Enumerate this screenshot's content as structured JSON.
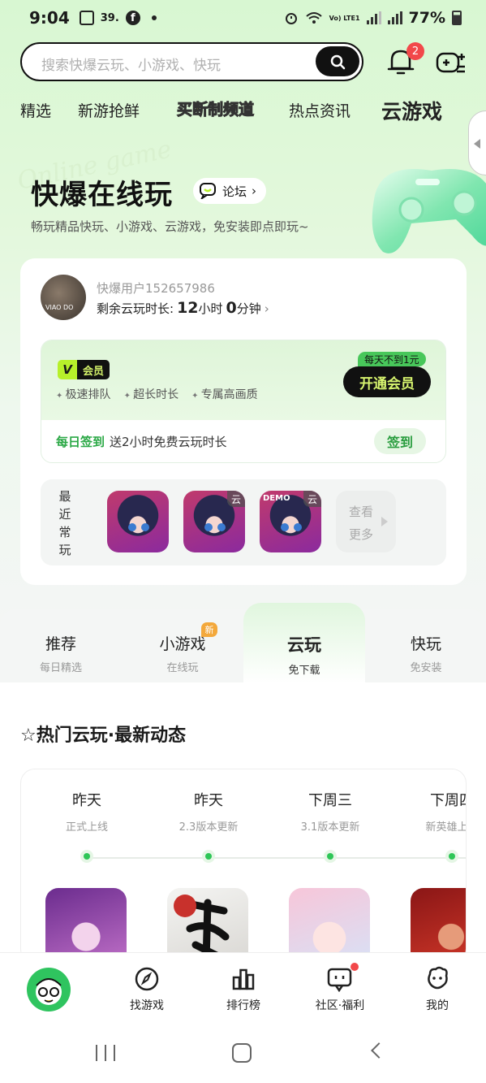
{
  "status_bar": {
    "time": "9:04",
    "notification_text": "39.",
    "battery": "77%",
    "network": "Vo) LTE1"
  },
  "search": {
    "placeholder": "搜索快爆云玩、小游戏、快玩",
    "notification_count": "2"
  },
  "top_tabs": [
    {
      "label": "精选"
    },
    {
      "label": "新游抢鲜"
    },
    {
      "label": "买断制频道"
    },
    {
      "label": "热点资讯"
    },
    {
      "label": "云游戏",
      "active": true
    }
  ],
  "hero": {
    "deco": "Online game",
    "title": "快爆在线玩",
    "forum_label": "论坛",
    "subtitle": "畅玩精品快玩、小游戏、云游戏，免安装即点即玩~"
  },
  "user": {
    "name": "快爆用户152657986",
    "avatar_text": "VIAO DO",
    "remaining_label": "剩余云玩时长:",
    "hours": "12",
    "hours_unit": "小时",
    "minutes": "0",
    "minutes_unit": "分钟"
  },
  "vip": {
    "badge_v": "V",
    "badge_label": "会员",
    "features": [
      "极速排队",
      "超长时长",
      "专属高画质"
    ],
    "promo_tag": "每天不到1元",
    "join_button": "开通会员",
    "checkin_title": "每日签到",
    "checkin_desc": "送2小时免费云玩时长",
    "checkin_button": "签到"
  },
  "recent": {
    "label": "最近常玩",
    "games": [
      {
        "tag": ""
      },
      {
        "tag": "云"
      },
      {
        "tag": "云",
        "demo": "DEMO"
      }
    ],
    "more_line1": "查看",
    "more_line2": "更多"
  },
  "category_tabs": [
    {
      "label": "推荐",
      "sub": "每日精选"
    },
    {
      "label": "小游戏",
      "sub": "在线玩",
      "badge": "新"
    },
    {
      "label": "云玩",
      "sub": "免下载",
      "active": true
    },
    {
      "label": "快玩",
      "sub": "免安装"
    }
  ],
  "section": {
    "title": "☆热门云玩·最新动态"
  },
  "timeline": [
    {
      "day": "昨天",
      "desc": "正式上线"
    },
    {
      "day": "昨天",
      "desc": "2.3版本更新"
    },
    {
      "day": "下周三",
      "desc": "3.1版本更新"
    },
    {
      "day": "下周四",
      "desc": "新英雄上线"
    }
  ],
  "bottom_nav": [
    {
      "label": "找游戏",
      "icon": "compass-icon"
    },
    {
      "label": "排行榜",
      "icon": "chart-icon"
    },
    {
      "label": "社区·福利",
      "icon": "chat-icon"
    },
    {
      "label": "我的",
      "icon": "profile-icon"
    }
  ],
  "colors": {
    "brand_green": "#2fc45f",
    "accent_lime": "#b7f02a",
    "badge_red": "#f2484a"
  }
}
